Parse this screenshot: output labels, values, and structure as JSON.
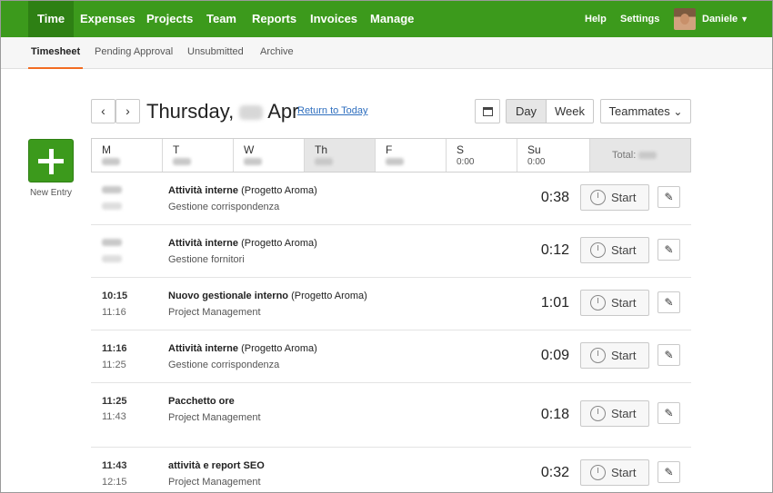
{
  "nav": {
    "items": [
      "Time",
      "Expenses",
      "Projects",
      "Team",
      "Reports",
      "Invoices",
      "Manage"
    ],
    "help": "Help",
    "settings": "Settings",
    "user": "Daniele"
  },
  "subnav": [
    "Timesheet",
    "Pending Approval",
    "Unsubmitted",
    "Archive"
  ],
  "new_entry_label": "New Entry",
  "header": {
    "weekday": "Thursday,",
    "month": "Apr",
    "return_link": "Return to Today",
    "view_day": "Day",
    "view_week": "Week",
    "teammates": "Teammates"
  },
  "days": [
    {
      "name": "M",
      "value": ""
    },
    {
      "name": "T",
      "value": ""
    },
    {
      "name": "W",
      "value": ""
    },
    {
      "name": "Th",
      "value": ""
    },
    {
      "name": "F",
      "value": ""
    },
    {
      "name": "S",
      "value": "0:00"
    },
    {
      "name": "Su",
      "value": "0:00"
    }
  ],
  "total_label": "Total:",
  "start_label": "Start",
  "entries": [
    {
      "start": "",
      "end": "",
      "task": "Attività interne",
      "project": "(Progetto Aroma)",
      "notes": "Gestione corrispondenza",
      "duration": "0:38"
    },
    {
      "start": "",
      "end": "",
      "task": "Attività interne",
      "project": "(Progetto Aroma)",
      "notes": "Gestione fornitori",
      "duration": "0:12"
    },
    {
      "start": "10:15",
      "end": "11:16",
      "task": "Nuovo gestionale interno",
      "project": "(Progetto Aroma)",
      "notes": "Project Management",
      "duration": "1:01"
    },
    {
      "start": "11:16",
      "end": "11:25",
      "task": "Attività interne",
      "project": "(Progetto Aroma)",
      "notes": "Gestione corrispondenza",
      "duration": "0:09"
    },
    {
      "start": "11:25",
      "end": "11:43",
      "task": "Pacchetto ore",
      "project": "",
      "notes": "Project Management",
      "duration": "0:18"
    },
    {
      "start": "11:43",
      "end": "12:15",
      "task": "attività e report SEO",
      "project": "",
      "notes": "Project Management",
      "duration": "0:32"
    }
  ]
}
